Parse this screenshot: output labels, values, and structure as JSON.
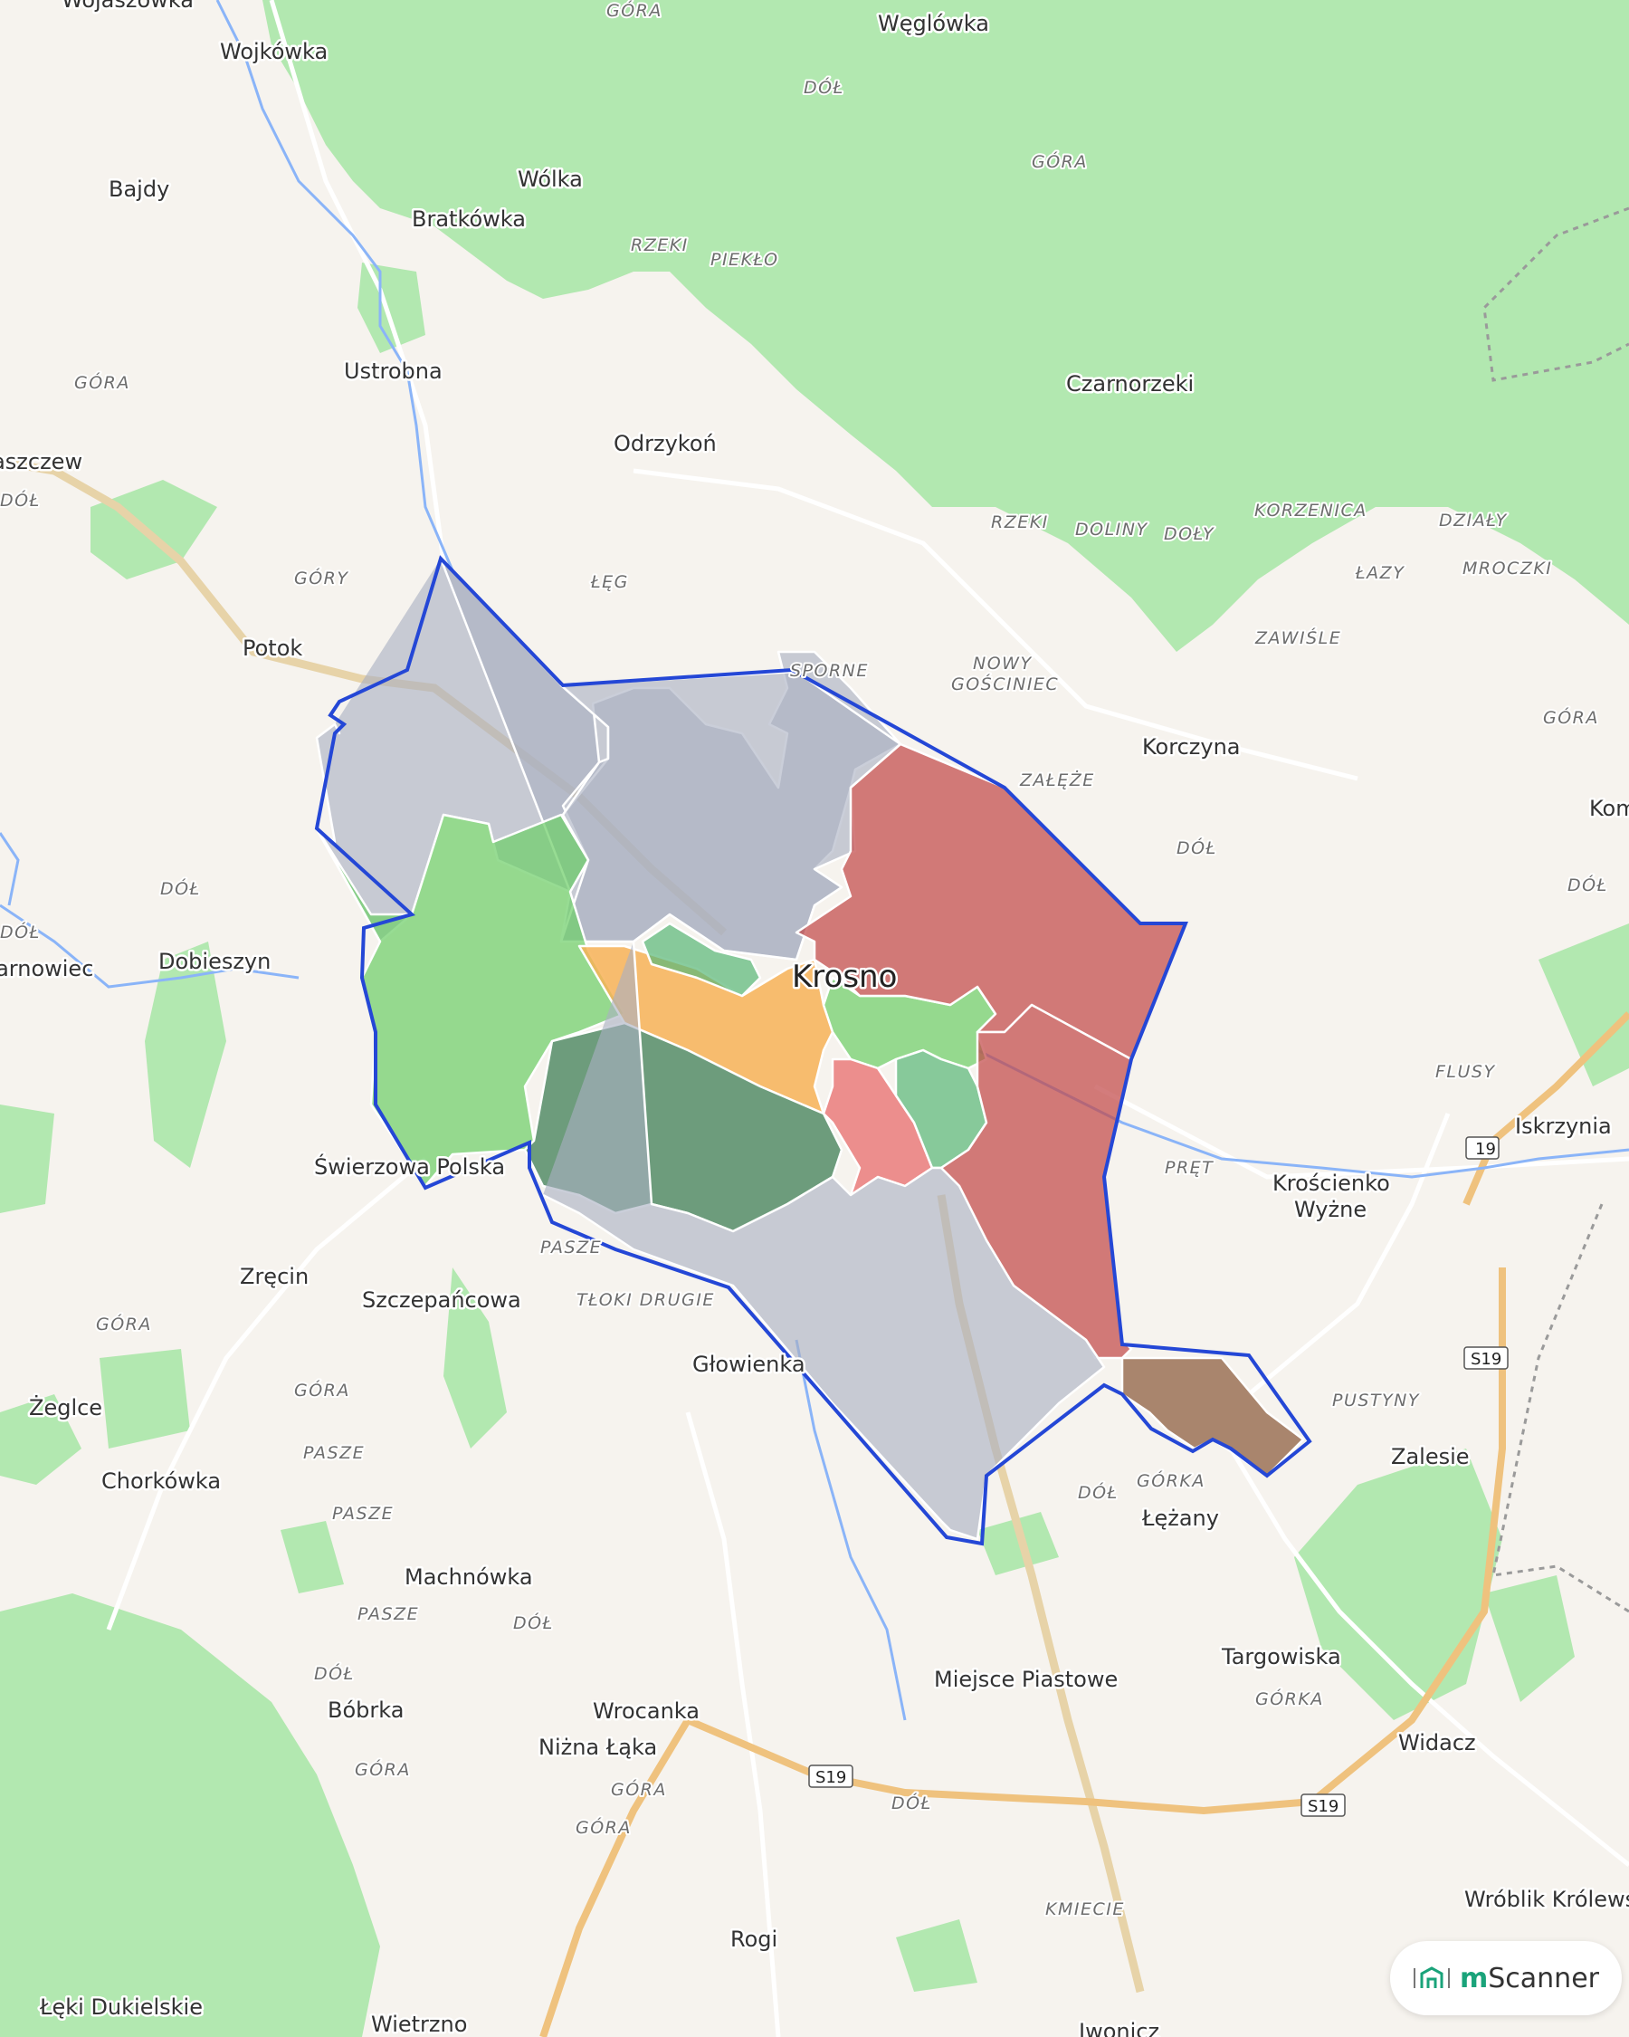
{
  "map": {
    "city": "Krosno",
    "places": [
      {
        "name": "Wojaszówka"
      },
      {
        "name": "Wojkówka"
      },
      {
        "name": "Węglówka"
      },
      {
        "name": "Bajdy"
      },
      {
        "name": "Wólka"
      },
      {
        "name": "Bratkówka"
      },
      {
        "name": "Ustrobna"
      },
      {
        "name": "Czarnorzeki"
      },
      {
        "name": "Odrzykoń"
      },
      {
        "name": "Jaszczew"
      },
      {
        "name": "Potok"
      },
      {
        "name": "Korczyna"
      },
      {
        "name": "Kom"
      },
      {
        "name": "Dobieszyn"
      },
      {
        "name": "Jarnowiec"
      },
      {
        "name": "Iskrzynia"
      },
      {
        "name": "Krościenko"
      },
      {
        "name": "Wyżne"
      },
      {
        "name": "Świerzowa Polska"
      },
      {
        "name": "Zręcin"
      },
      {
        "name": "Szczepańcowa"
      },
      {
        "name": "Głowienka"
      },
      {
        "name": "Żeglce"
      },
      {
        "name": "Chorkówka"
      },
      {
        "name": "Zalesie"
      },
      {
        "name": "Łężany"
      },
      {
        "name": "Machnówka"
      },
      {
        "name": "Targowiska"
      },
      {
        "name": "Miejsce Piastowe"
      },
      {
        "name": "Bóbrka"
      },
      {
        "name": "Wrocanka"
      },
      {
        "name": "Niżna Łąka"
      },
      {
        "name": "Widacz"
      },
      {
        "name": "Wróblik Królewski"
      },
      {
        "name": "Rogi"
      },
      {
        "name": "Łęki Dukielskie"
      },
      {
        "name": "Wietrzno"
      },
      {
        "name": "Iwonicz"
      }
    ],
    "localities": [
      "GÓRA",
      "DÓŁ",
      "GÓRA",
      "RZEKI",
      "PIEKŁO",
      "GÓRA",
      "GÓRY",
      "ŁĘG",
      "DÓŁ",
      "RZEKI",
      "DOLINY",
      "DOŁY",
      "KORZENICA",
      "DZIAŁY",
      "ŁAZY",
      "MROCZKI",
      "ZAWIŚLE",
      "SPORNE",
      "NOWY",
      "GOŚCINIEC",
      "ZAŁĘŻE",
      "GÓRA",
      "DÓŁ",
      "DÓŁ",
      "DÓŁ",
      "DÓŁ",
      "FLUSY",
      "PRĘT",
      "PASZE",
      "TŁOKI DRUGIE",
      "GÓRA",
      "GÓRA",
      "PASZE",
      "PASZE",
      "PASZE",
      "DÓŁ",
      "DÓŁ",
      "GÓRA",
      "GÓRA",
      "GÓRA",
      "DÓŁ",
      "GÓRKA",
      "PUSTYNY",
      "GÓRKA",
      "DÓŁ",
      "KMIECIE"
    ],
    "roads": [
      "19",
      "S19",
      "S19",
      "S19"
    ],
    "district_colors": {
      "grey": "#aab0c2",
      "green_light": "#6fcf6a",
      "green_dark": "#3f7f55",
      "green_mid": "#5cb87a",
      "orange": "#f7b257",
      "red": "#c24a4a",
      "brown": "#8a5a3c"
    },
    "boundary_color": "#2447d6",
    "forest_color": "#b2e8b0"
  },
  "brand": {
    "prefix": "m",
    "name": "Scanner"
  }
}
